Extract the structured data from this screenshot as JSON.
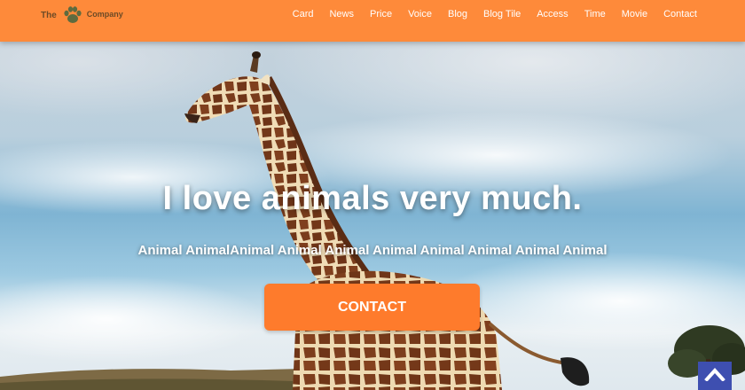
{
  "brand": {
    "name_left": "The",
    "name_right": "Company",
    "logo_icon": "paw-icon"
  },
  "nav": {
    "items": [
      {
        "label": "Card"
      },
      {
        "label": "News"
      },
      {
        "label": "Price"
      },
      {
        "label": "Voice"
      },
      {
        "label": "Blog"
      },
      {
        "label": "Blog Tile"
      },
      {
        "label": "Access"
      },
      {
        "label": "Time"
      },
      {
        "label": "Movie"
      },
      {
        "label": "Contact"
      }
    ]
  },
  "hero": {
    "title": "I love animals very much.",
    "subtitle": "Animal AnimalAnimal Animal Animal Animal Animal Animal Animal Animal",
    "cta_label": "CONTACT",
    "background": "giraffe-photo"
  },
  "scroll_top": {
    "icon": "chevron-up-icon"
  },
  "colors": {
    "header": "#fe8a3a",
    "cta": "#fe7b2c",
    "scroll_top": "#3e4fb0",
    "logo_text": "#6b4a26"
  }
}
